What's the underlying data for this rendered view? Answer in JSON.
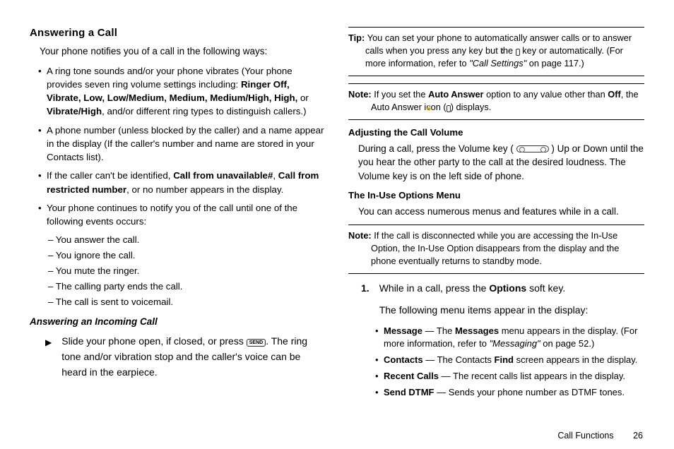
{
  "left": {
    "heading": "Answering a Call",
    "intro": "Your phone notifies you of a call in the following ways:",
    "bullets": {
      "b1_pre": "A ring tone sounds and/or your phone vibrates (Your phone provides seven ring volume settings including: ",
      "b1_bold": "Ringer Off, Vibrate, Low, Low/Medium, Medium, Medium/High, High, ",
      "b1_or": "or ",
      "b1_bold2": "Vibrate/High",
      "b1_post": ", and/or different ring types to distinguish callers.)",
      "b2": "A phone number (unless blocked by the caller) and a name appear in the display (If the caller's number and name are stored in your Contacts list).",
      "b3_pre": "If the caller can't be identified, ",
      "b3_b1": "Call from unavailable#",
      "b3_mid": ", ",
      "b3_b2": "Call from restricted number",
      "b3_post": ", or no number appears in the display.",
      "b4": "Your phone continues to notify you of the call until one of the following events occurs:"
    },
    "sub": {
      "s1": "– You answer the call.",
      "s2": "– You ignore the call.",
      "s3": "– You mute the ringer.",
      "s4": "– The calling party ends the call.",
      "s5": "– The call is sent to voicemail."
    },
    "sub_heading": "Answering an Incoming Call",
    "step_pre": "Slide your phone open, if closed, or press ",
    "step_icon": "SEND",
    "step_post": ". The ring tone and/or vibration stop and the caller's voice can be heard in the earpiece."
  },
  "right": {
    "tip_label": "Tip: ",
    "tip_pre": "You can set your phone to automatically answer calls or to answer calls when you press any key but the ",
    "tip_icon": "⏻",
    "tip_mid": " key or automatically. (For more information, refer to ",
    "tip_ref": "\"Call Settings\"",
    "tip_post": "  on page 117.)",
    "note1_label": "Note: ",
    "note1_pre": "If you set the ",
    "note1_b1": "Auto Answer",
    "note1_mid": " option to any value other than ",
    "note1_b2": "Off",
    "note1_post": ", the Auto Answer icon (",
    "note1_icon": "🔒",
    "note1_end": ") displays.",
    "h_adjust": "Adjusting the Call Volume",
    "adjust_pre": "During a call, press the Volume key ( ",
    "adjust_post": " ) Up or Down until the you hear the other party to the call at the desired loudness. The Volume key is on the left side of phone.",
    "h_inuse": "The In-Use Options Menu",
    "inuse_body": "You can access numerous menus and features while in a call.",
    "note2_label": "Note: ",
    "note2_body": "If the call is disconnected while you are accessing the In-Use Option, the In-Use Option disappears from the display and the phone eventually returns to standby mode.",
    "step1_num": "1.",
    "step1_pre": "While in a call, press the ",
    "step1_b": "Options",
    "step1_post": " soft key.",
    "step1_body2": "The following menu items appear in the display:",
    "opts": {
      "m_b": "Message",
      "m_t_pre": " — The ",
      "m_t_b": "Messages",
      "m_t_mid": " menu appears in the display. (For more information, refer to ",
      "m_t_ref": "\"Messaging\"",
      "m_t_post": "  on page 52.)",
      "c_b": "Contacts",
      "c_t_pre": " — The Contacts ",
      "c_t_b": "Find",
      "c_t_post": " screen appears in the display.",
      "r_b": "Recent Calls",
      "r_t": " — The recent calls list appears in the display.",
      "d_b": "Send DTMF",
      "d_t": " — Sends your phone number as DTMF tones."
    }
  },
  "footer": {
    "section": "Call Functions",
    "page": "26"
  }
}
